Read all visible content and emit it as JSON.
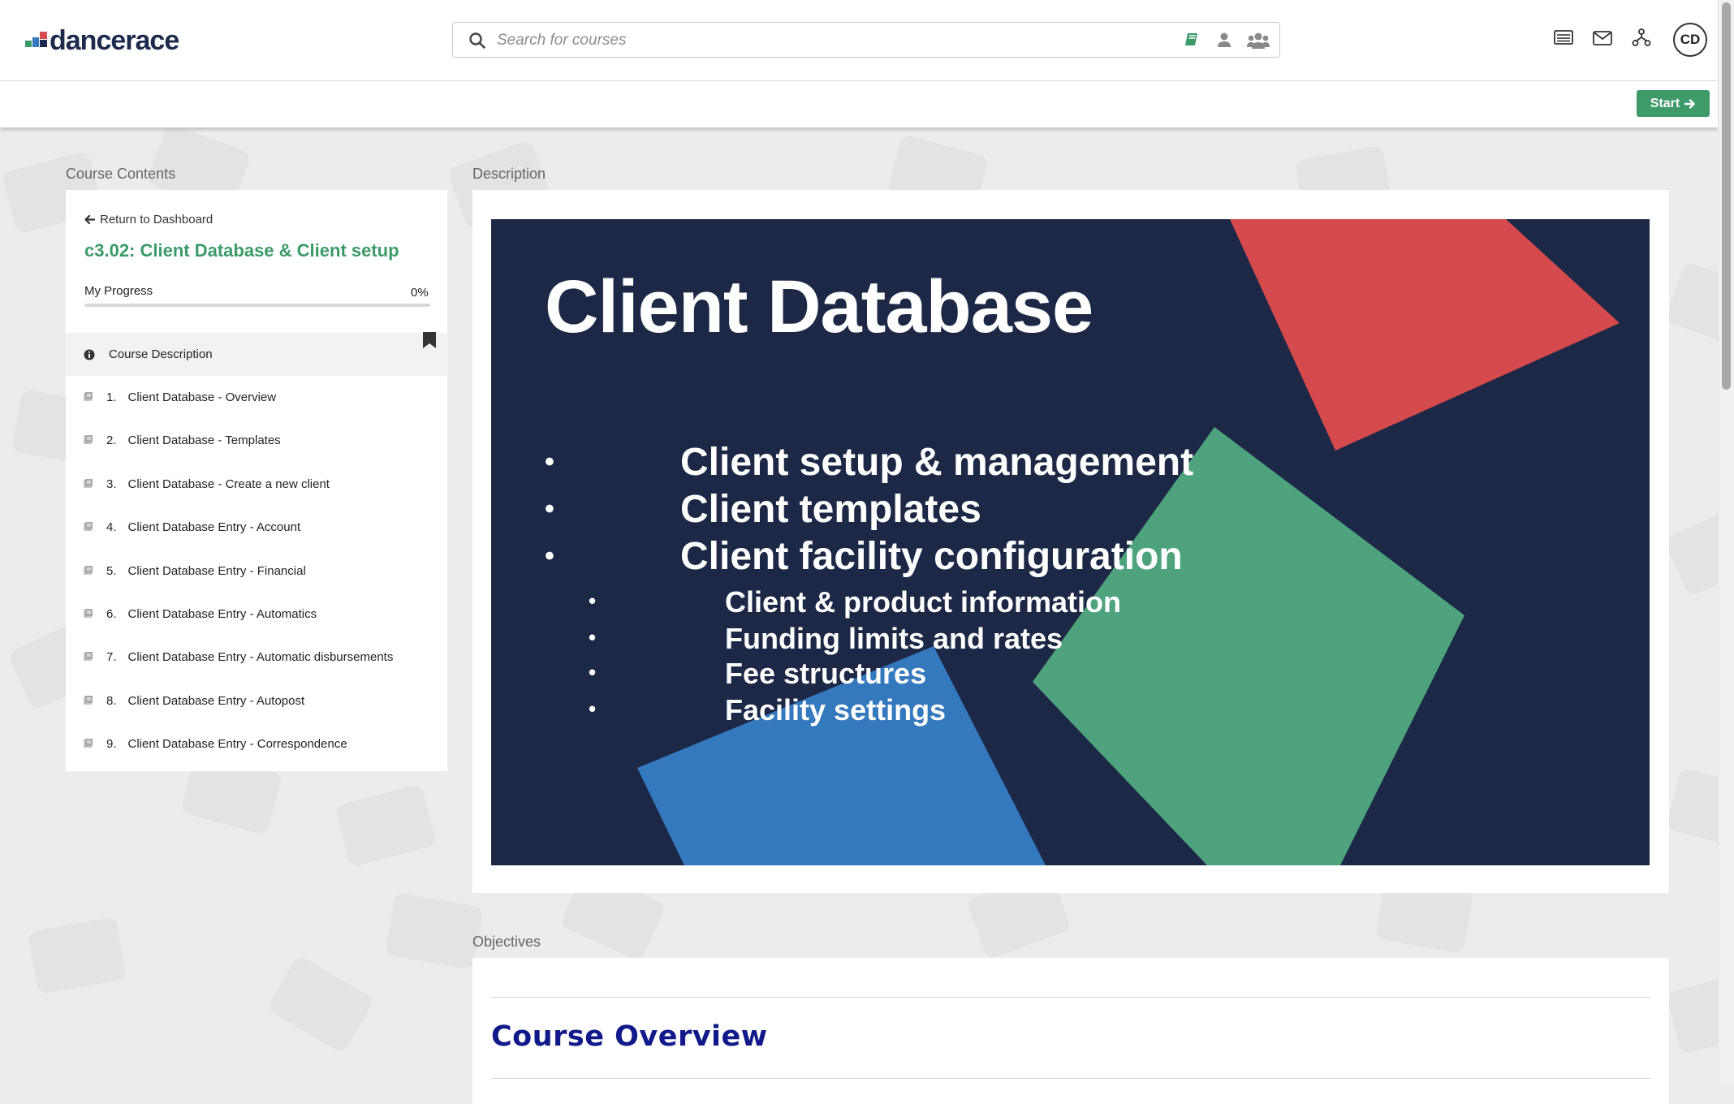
{
  "brand": {
    "name": "dancerace"
  },
  "search": {
    "placeholder": "Search for courses"
  },
  "header": {
    "icons": [
      "courses-book-icon",
      "person-icon",
      "group-icon",
      "news-icon",
      "mail-icon",
      "org-chart-icon"
    ],
    "avatar_initials": "CD"
  },
  "toolbar": {
    "start_label": "Start"
  },
  "sidebar": {
    "section_label": "Course Contents",
    "return_label": "Return to Dashboard",
    "course_title": "c3.02: Client Database & Client setup",
    "progress_label": "My Progress",
    "progress_value": "0%",
    "progress_fraction": 0,
    "description_item": "Course Description",
    "lessons": [
      {
        "num": "1.",
        "title": "Client Database - Overview"
      },
      {
        "num": "2.",
        "title": "Client Database - Templates"
      },
      {
        "num": "3.",
        "title": "Client Database - Create a new client"
      },
      {
        "num": "4.",
        "title": "Client Database Entry - Account"
      },
      {
        "num": "5.",
        "title": "Client Database Entry - Financial"
      },
      {
        "num": "6.",
        "title": "Client Database Entry - Automatics"
      },
      {
        "num": "7.",
        "title": "Client Database Entry - Automatic disbursements"
      },
      {
        "num": "8.",
        "title": "Client Database Entry - Autopost"
      },
      {
        "num": "9.",
        "title": "Client Database Entry - Correspondence"
      }
    ]
  },
  "main": {
    "description_label": "Description",
    "slide": {
      "title": "Client Database",
      "bullets": [
        "Client setup & management",
        "Client templates",
        "Client facility configuration"
      ],
      "sub_bullets": [
        "Client & product information",
        "Funding limits and rates",
        "Fee structures",
        "Facility settings"
      ]
    },
    "objectives_label": "Objectives",
    "objectives_heading": "Course Overview"
  },
  "colors": {
    "accent_green": "#3a9b68",
    "slide_background": "#1d2847",
    "slide_red": "#d54a4c",
    "slide_green": "#4ea37c",
    "slide_blue": "#3478bd",
    "heading_blue": "#101a8a"
  }
}
